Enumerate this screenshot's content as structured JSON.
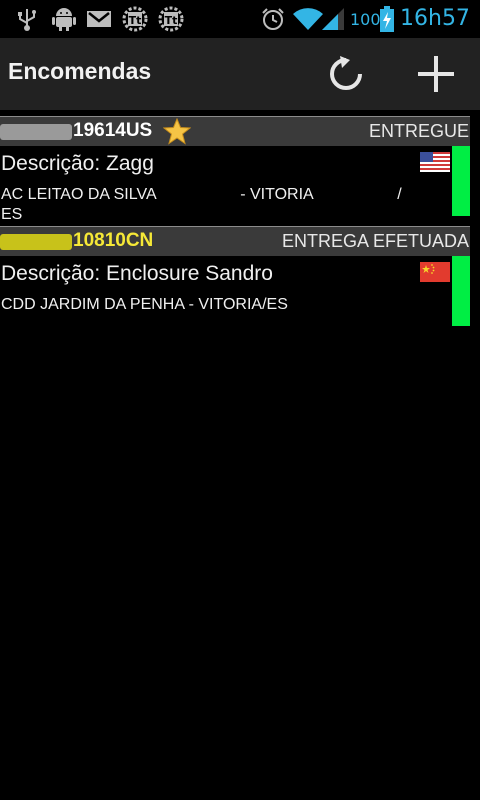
{
  "statusbar": {
    "battery_level": "100",
    "time": "16h57",
    "notification_icons": [
      "usb-icon",
      "android-debug-icon",
      "gmail-icon",
      "app-notification-icon",
      "app-notification-icon"
    ],
    "system_icons": [
      "alarm-icon",
      "wifi-icon",
      "signal-icon",
      "battery-charging-icon"
    ]
  },
  "actionbar": {
    "title": "Encomendas",
    "refresh_icon": "refresh-icon",
    "add_icon": "add-icon"
  },
  "packages": [
    {
      "code": "19614US",
      "code_color": "#ffffff",
      "blur_color": "#9a9a9a",
      "starred": true,
      "status": "ENTREGUE",
      "description": "Descrição: Zagg",
      "location_line1": "AC LEITAO DA SILVA                   - VITORIA                   /",
      "location_line2": "ES",
      "flag": "usa-flag-icon",
      "status_color": "#00ee44"
    },
    {
      "code": "10810CN",
      "code_color": "#f5e837",
      "blur_color": "#c8c21a",
      "starred": false,
      "status": "ENTREGA EFETUADA",
      "description": "Descrição: Enclosure Sandro",
      "location_line1": "CDD JARDIM DA PENHA - VITORIA/ES",
      "location_line2": "",
      "flag": "china-flag-icon",
      "status_color": "#00ee44"
    }
  ]
}
